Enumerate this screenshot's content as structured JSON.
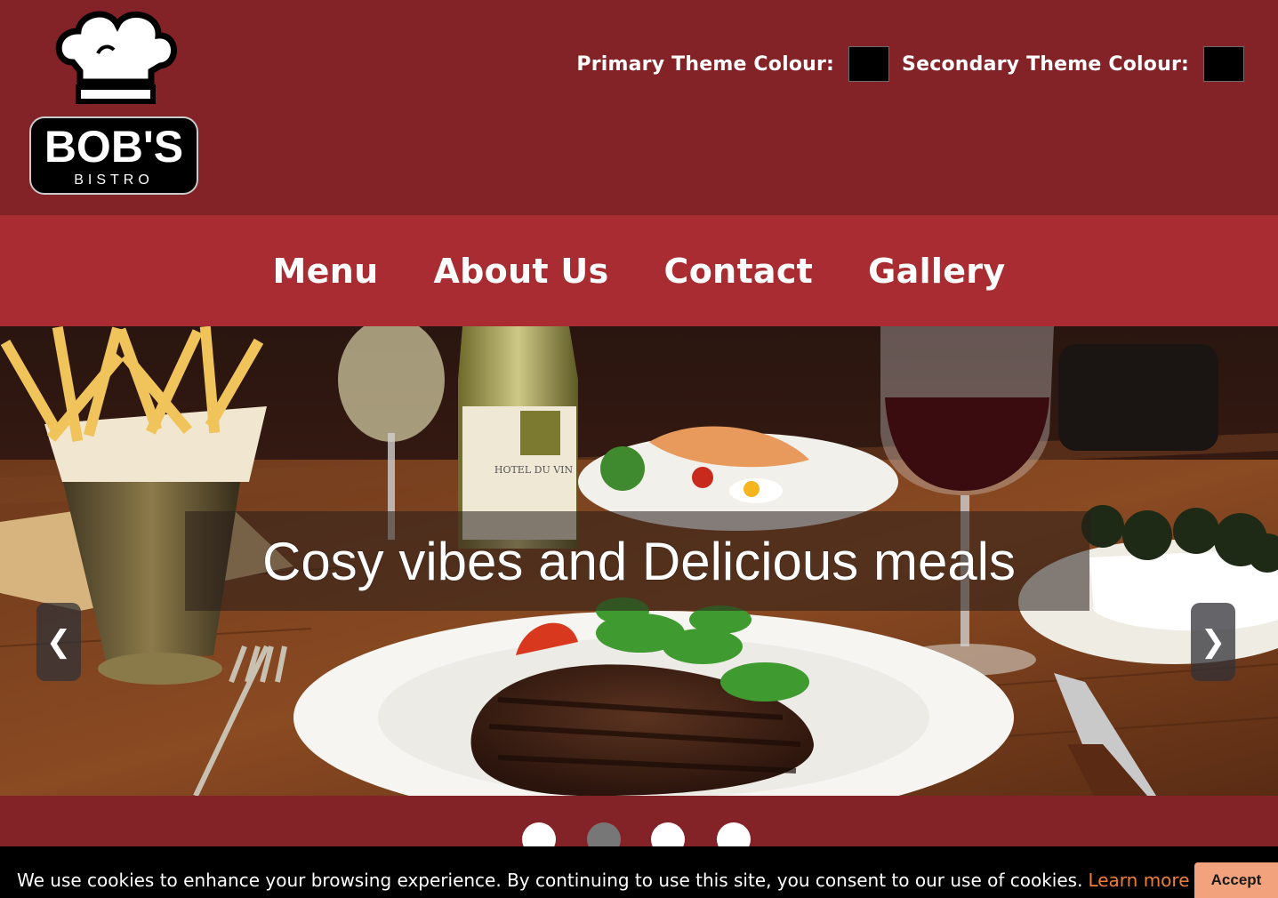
{
  "brand": {
    "name": "BOB'S",
    "subtitle": "BISTRO"
  },
  "theme": {
    "primary_label": "Primary Theme Colour:",
    "secondary_label": "Secondary Theme Colour:",
    "primary_value": "#000000",
    "secondary_value": "#000000"
  },
  "nav": {
    "items": [
      {
        "label": "Menu"
      },
      {
        "label": "About Us"
      },
      {
        "label": "Contact"
      },
      {
        "label": "Gallery"
      }
    ]
  },
  "hero": {
    "caption": "Cosy vibes and Delicious meals",
    "prev": "❮",
    "next": "❯",
    "bottle_label": "HOTEL DU VIN",
    "slide_count": 4,
    "active_slide": 2
  },
  "cookie": {
    "text": "We use cookies to enhance your browsing experience. By continuing to use this site, you consent to our use of cookies.",
    "link": "Learn more",
    "accept": "Accept"
  },
  "colors": {
    "header_bg": "#842327",
    "nav_bg": "#a82c31",
    "cookie_bg": "#000000",
    "link": "#f07e38",
    "accept_bg": "#f2a27c"
  }
}
